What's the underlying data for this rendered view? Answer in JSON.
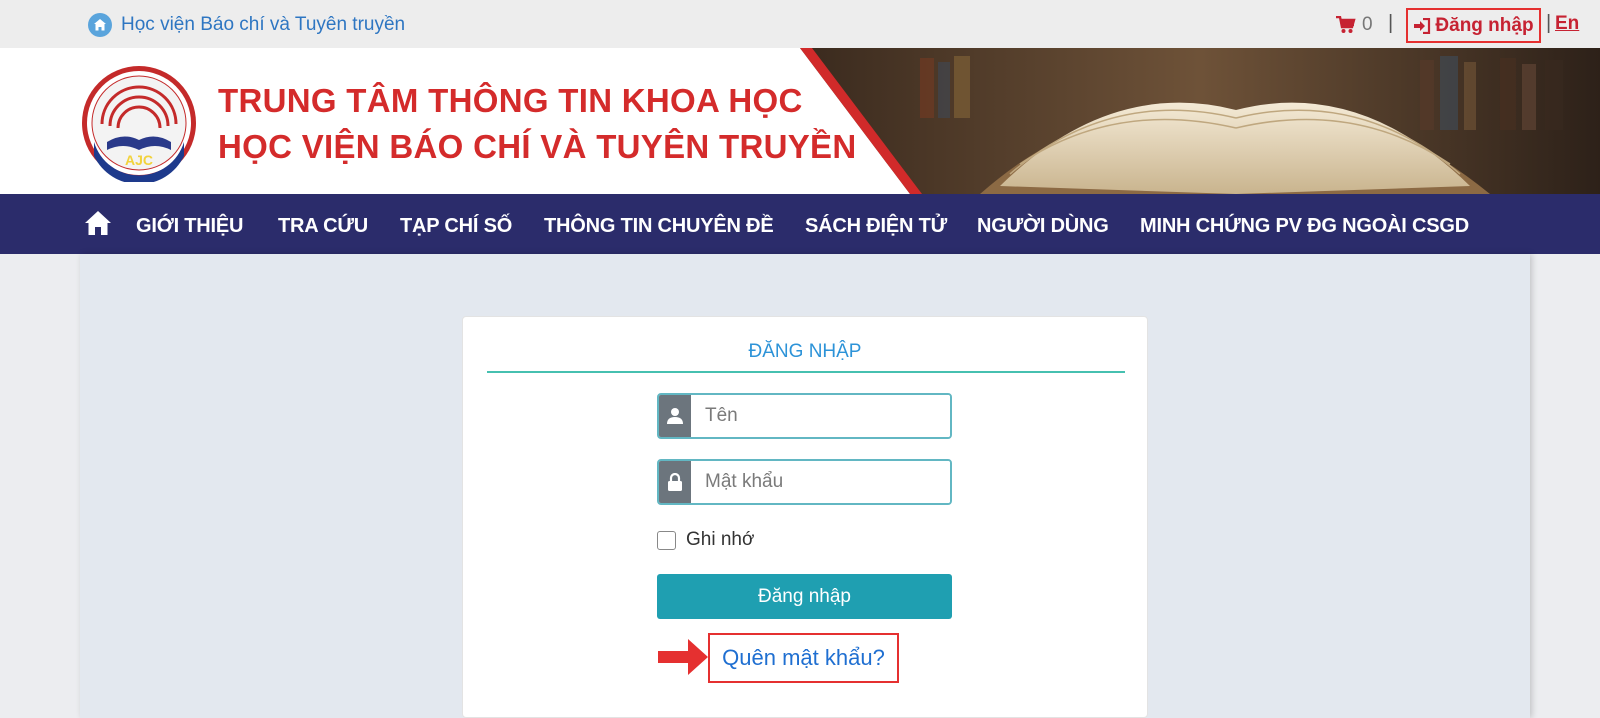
{
  "topbar": {
    "institute_link": "Học viện Báo chí và Tuyên truyền",
    "cart_count": "0",
    "separator": "|",
    "login_label": "Đăng nhập",
    "lang_label": "En"
  },
  "banner": {
    "title_line1": "TRUNG TÂM THÔNG TIN KHOA HỌC",
    "title_line2": "HỌC VIỆN BÁO CHÍ VÀ TUYÊN TRUYỀN",
    "logo_text": "AJC"
  },
  "nav": {
    "items": [
      "GIỚI THIỆU",
      "TRA CỨU",
      "TẠP CHÍ SỐ",
      "THÔNG TIN CHUYÊN ĐỀ",
      "SÁCH ĐIỆN TỬ",
      "NGƯỜI DÙNG",
      "MINH CHỨNG PV ĐG NGOÀI CSGD"
    ]
  },
  "login_form": {
    "title": "ĐĂNG NHẬP",
    "username_placeholder": "Tên",
    "password_placeholder": "Mật khẩu",
    "remember_label": "Ghi nhớ",
    "submit_label": "Đăng nhập",
    "forgot_label": "Quên mật khẩu?"
  },
  "colors": {
    "nav_bg": "#2b2c6b",
    "title_red": "#d42b2b",
    "button_teal": "#1f9fb1",
    "highlight_red": "#e53030"
  }
}
